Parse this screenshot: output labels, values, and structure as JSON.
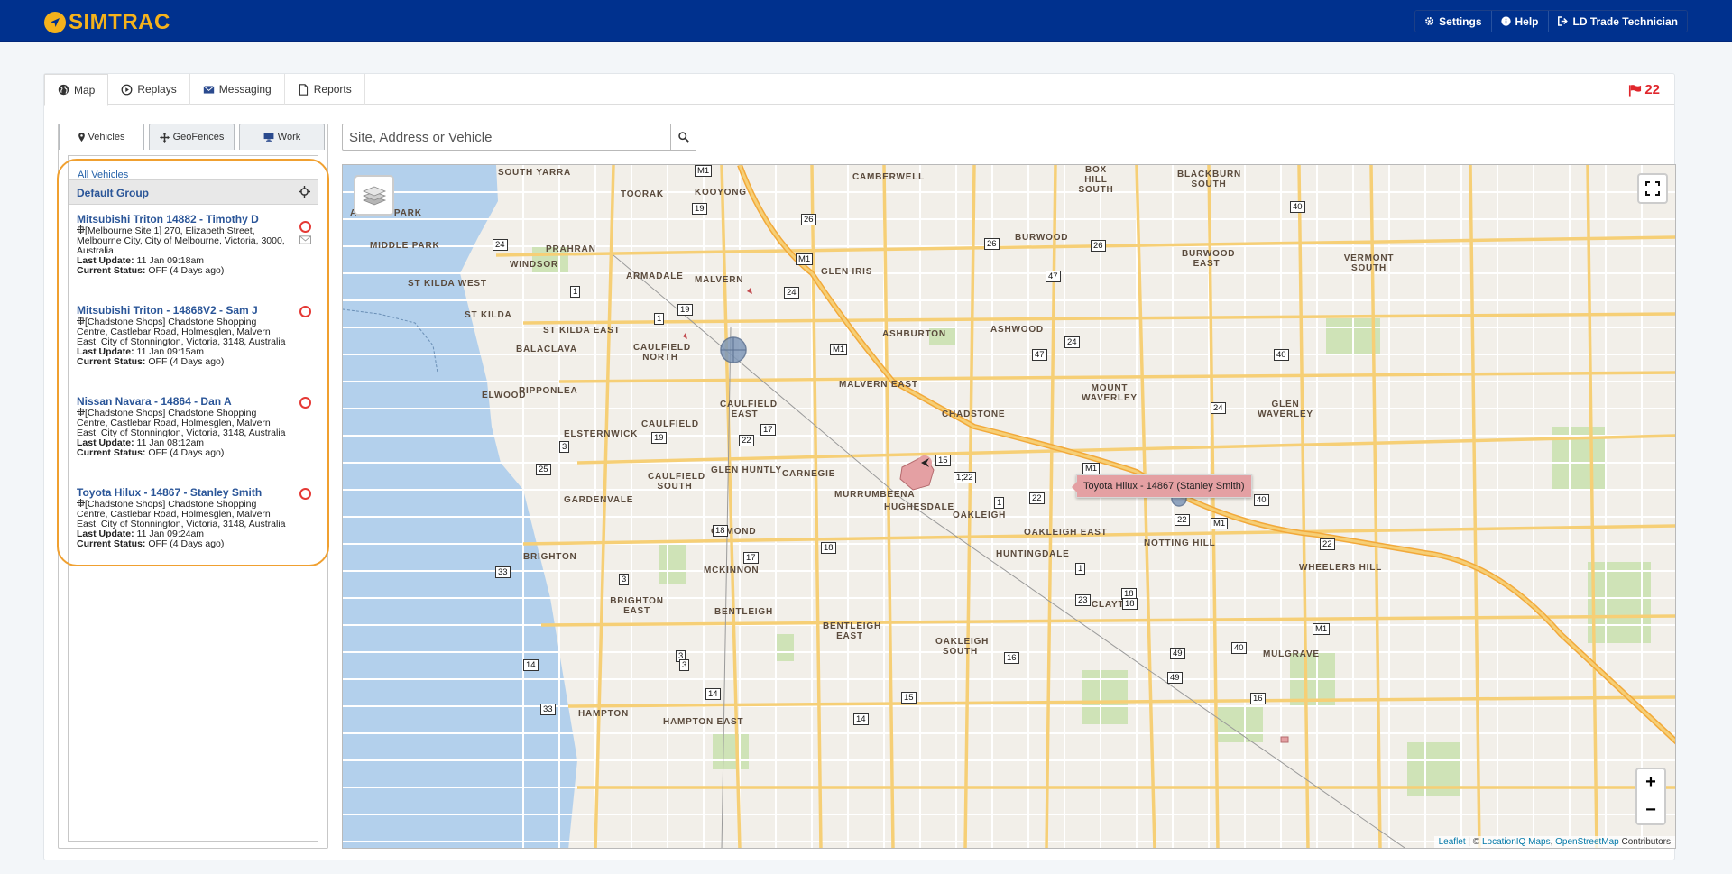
{
  "app": {
    "brand": "SIMTRAC"
  },
  "topnav": {
    "settings": "Settings",
    "help": "Help",
    "user": "LD Trade Technician"
  },
  "tabs": [
    {
      "label": "Map",
      "icon": "globe-icon"
    },
    {
      "label": "Replays",
      "icon": "play-circle-icon"
    },
    {
      "label": "Messaging",
      "icon": "envelope-icon"
    },
    {
      "label": "Reports",
      "icon": "document-icon"
    }
  ],
  "alerts": {
    "count": "22",
    "icon": "flag-icon",
    "color": "#e0262c"
  },
  "subtabs": [
    {
      "label": "Vehicles",
      "icon": "map-marker-icon"
    },
    {
      "label": "GeoFences",
      "icon": "move-icon"
    },
    {
      "label": "Work",
      "icon": "monitor-icon"
    }
  ],
  "sidebar": {
    "all_vehicles": "All Vehicles",
    "group_name": "Default Group",
    "vehicles": [
      {
        "title": "Mitsubishi Triton 14882 - Timothy D",
        "address": "[Melbourne Site 1] 270, Elizabeth Street, Melbourne City, City of Melbourne, Victoria, 3000, Australia",
        "last_update_label": "Last Update:",
        "last_update": "11 Jan 09:18am",
        "status_label": "Current Status:",
        "status": "OFF (4 Days ago)"
      },
      {
        "title": "Mitsubishi Triton - 14868V2 - Sam J",
        "address": "[Chadstone Shops] Chadstone Shopping Centre, Castlebar Road, Holmesglen, Malvern East, City of Stonnington, Victoria, 3148, Australia",
        "last_update_label": "Last Update:",
        "last_update": "11 Jan 09:15am",
        "status_label": "Current Status:",
        "status": "OFF (4 Days ago)"
      },
      {
        "title": "Nissan Navara - 14864 - Dan A",
        "address": "[Chadstone Shops] Chadstone Shopping Centre, Castlebar Road, Holmesglen, Malvern East, City of Stonnington, Victoria, 3148, Australia",
        "last_update_label": "Last Update:",
        "last_update": "11 Jan 08:12am",
        "status_label": "Current Status:",
        "status": "OFF (4 Days ago)"
      },
      {
        "title": "Toyota Hilux - 14867 - Stanley Smith",
        "address": "[Chadstone Shops] Chadstone Shopping Centre, Castlebar Road, Holmesglen, Malvern East, City of Stonnington, Victoria, 3148, Australia",
        "last_update_label": "Last Update:",
        "last_update": "11 Jan 09:24am",
        "status_label": "Current Status:",
        "status": "OFF (4 Days ago)"
      }
    ]
  },
  "search": {
    "placeholder": "Site, Address or Vehicle"
  },
  "map": {
    "tooltip": "Toyota Hilux - 14867 (Stanley Smith)",
    "zoom_in": "+",
    "zoom_out": "−",
    "attribution": {
      "leaflet": "Leaflet",
      "sep": " | © ",
      "liq": "LocationIQ Maps",
      "comma": ", ",
      "osm": "OpenStreetMap",
      "contrib": " Contributors"
    },
    "suburbs": [
      "SOUTH YARRA",
      "CAMBERWELL",
      "BLACKBURN SOUTH",
      "BOX HILL SOUTH",
      "TOORAK",
      "KOOYONG",
      "ALBERT PARK",
      "MIDDLE PARK",
      "PRAHRAN",
      "BURWOOD",
      "BURWOOD EAST",
      "VERMONT SOUTH",
      "WINDSOR",
      "GLEN IRIS",
      "ARMADALE",
      "MALVERN",
      "ST KILDA WEST",
      "ST KILDA",
      "ST KILDA EAST",
      "ASHBURTON",
      "ASHWOOD",
      "BALACLAVA",
      "CAULFIELD NORTH",
      "MALVERN EAST",
      "MOUNT WAVERLEY",
      "GLEN WAVERLEY",
      "ELWOOD",
      "RIPPONLEA",
      "CAULFIELD EAST",
      "CHADSTONE",
      "ELSTERNWICK",
      "CAULFIELD",
      "GLEN HUNTLY",
      "CARNEGIE",
      "CAULFIELD SOUTH",
      "MURRUMBEENA",
      "HUGHESDALE",
      "OAKLEIGH",
      "GARDENVALE",
      "OAKLEIGH EAST",
      "NOTTING HILL",
      "WHEELERS HILL",
      "ORMOND",
      "HUNTINGDALE",
      "BRIGHTON",
      "MCKINNON",
      "CLAYTON",
      "BRIGHTON EAST",
      "BENTLEIGH",
      "BENTLEIGH EAST",
      "OAKLEIGH SOUTH",
      "MULGRAVE",
      "HAMPTON",
      "HAMPTON EAST"
    ],
    "shields": [
      "M1",
      "19",
      "26",
      "24",
      "M1",
      "1",
      "19",
      "1",
      "24",
      "M1",
      "26",
      "26",
      "47",
      "24",
      "47",
      "40",
      "24",
      "40",
      "40",
      "17",
      "22",
      "19",
      "3",
      "25",
      "15",
      "1;22",
      "M1",
      "1",
      "22",
      "22",
      "M1",
      "22",
      "18",
      "17",
      "18",
      "33",
      "3",
      "1",
      "23",
      "18",
      "40",
      "M1",
      "49",
      "49",
      "3",
      "3",
      "14",
      "14",
      "15",
      "16",
      "33",
      "14",
      "16",
      "18"
    ]
  }
}
